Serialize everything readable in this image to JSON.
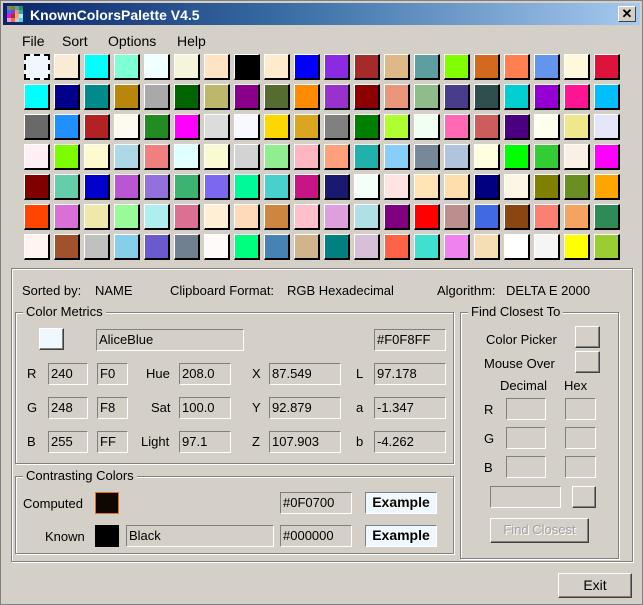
{
  "window": {
    "title": "KnownColorsPalette V4.5",
    "close_label": "✕"
  },
  "menu": [
    "File",
    "Sort",
    "Options",
    "Help"
  ],
  "palette": {
    "selected_index": 0,
    "colors": [
      {
        "name": "AliceBlue",
        "hex": "#F0F8FF"
      },
      {
        "name": "AntiqueWhite",
        "hex": "#FAEBD7"
      },
      {
        "name": "Aqua",
        "hex": "#00FFFF"
      },
      {
        "name": "Aquamarine",
        "hex": "#7FFFD4"
      },
      {
        "name": "Azure",
        "hex": "#F0FFFF"
      },
      {
        "name": "Beige",
        "hex": "#F5F5DC"
      },
      {
        "name": "Bisque",
        "hex": "#FFE4C4"
      },
      {
        "name": "Black",
        "hex": "#000000"
      },
      {
        "name": "BlanchedAlmond",
        "hex": "#FFEBCD"
      },
      {
        "name": "Blue",
        "hex": "#0000FF"
      },
      {
        "name": "BlueViolet",
        "hex": "#8A2BE2"
      },
      {
        "name": "Brown",
        "hex": "#A52A2A"
      },
      {
        "name": "BurlyWood",
        "hex": "#DEB887"
      },
      {
        "name": "CadetBlue",
        "hex": "#5F9EA0"
      },
      {
        "name": "Chartreuse",
        "hex": "#7FFF00"
      },
      {
        "name": "Chocolate",
        "hex": "#D2691E"
      },
      {
        "name": "Coral",
        "hex": "#FF7F50"
      },
      {
        "name": "CornflowerBlue",
        "hex": "#6495ED"
      },
      {
        "name": "Cornsilk",
        "hex": "#FFF8DC"
      },
      {
        "name": "Crimson",
        "hex": "#DC143C"
      },
      {
        "name": "Cyan",
        "hex": "#00FFFF"
      },
      {
        "name": "DarkBlue",
        "hex": "#00008B"
      },
      {
        "name": "DarkCyan",
        "hex": "#008B8B"
      },
      {
        "name": "DarkGoldenrod",
        "hex": "#B8860B"
      },
      {
        "name": "DarkGray",
        "hex": "#A9A9A9"
      },
      {
        "name": "DarkGreen",
        "hex": "#006400"
      },
      {
        "name": "DarkKhaki",
        "hex": "#BDB76B"
      },
      {
        "name": "DarkMagenta",
        "hex": "#8B008B"
      },
      {
        "name": "DarkOliveGreen",
        "hex": "#556B2F"
      },
      {
        "name": "DarkOrange",
        "hex": "#FF8C00"
      },
      {
        "name": "DarkOrchid",
        "hex": "#9932CC"
      },
      {
        "name": "DarkRed",
        "hex": "#8B0000"
      },
      {
        "name": "DarkSalmon",
        "hex": "#E9967A"
      },
      {
        "name": "DarkSeaGreen",
        "hex": "#8FBC8B"
      },
      {
        "name": "DarkSlateBlue",
        "hex": "#483D8B"
      },
      {
        "name": "DarkSlateGray",
        "hex": "#2F4F4F"
      },
      {
        "name": "DarkTurquoise",
        "hex": "#00CED1"
      },
      {
        "name": "DarkViolet",
        "hex": "#9400D3"
      },
      {
        "name": "DeepPink",
        "hex": "#FF1493"
      },
      {
        "name": "DeepSkyBlue",
        "hex": "#00BFFF"
      },
      {
        "name": "DimGray",
        "hex": "#696969"
      },
      {
        "name": "DodgerBlue",
        "hex": "#1E90FF"
      },
      {
        "name": "Firebrick",
        "hex": "#B22222"
      },
      {
        "name": "FloralWhite",
        "hex": "#FFFAF0"
      },
      {
        "name": "ForestGreen",
        "hex": "#228B22"
      },
      {
        "name": "Fuchsia",
        "hex": "#FF00FF"
      },
      {
        "name": "Gainsboro",
        "hex": "#DCDCDC"
      },
      {
        "name": "GhostWhite",
        "hex": "#F8F8FF"
      },
      {
        "name": "Gold",
        "hex": "#FFD700"
      },
      {
        "name": "Goldenrod",
        "hex": "#DAA520"
      },
      {
        "name": "Gray",
        "hex": "#808080"
      },
      {
        "name": "Green",
        "hex": "#008000"
      },
      {
        "name": "GreenYellow",
        "hex": "#ADFF2F"
      },
      {
        "name": "Honeydew",
        "hex": "#F0FFF0"
      },
      {
        "name": "HotPink",
        "hex": "#FF69B4"
      },
      {
        "name": "IndianRed",
        "hex": "#CD5C5C"
      },
      {
        "name": "Indigo",
        "hex": "#4B0082"
      },
      {
        "name": "Ivory",
        "hex": "#FFFFF0"
      },
      {
        "name": "Khaki",
        "hex": "#F0E68C"
      },
      {
        "name": "Lavender",
        "hex": "#E6E6FA"
      },
      {
        "name": "LavenderBlush",
        "hex": "#FFF0F5"
      },
      {
        "name": "LawnGreen",
        "hex": "#7CFC00"
      },
      {
        "name": "LemonChiffon",
        "hex": "#FFFACD"
      },
      {
        "name": "LightBlue",
        "hex": "#ADD8E6"
      },
      {
        "name": "LightCoral",
        "hex": "#F08080"
      },
      {
        "name": "LightCyan",
        "hex": "#E0FFFF"
      },
      {
        "name": "LightGoldenrodYellow",
        "hex": "#FAFAD2"
      },
      {
        "name": "LightGray",
        "hex": "#D3D3D3"
      },
      {
        "name": "LightGreen",
        "hex": "#90EE90"
      },
      {
        "name": "LightPink",
        "hex": "#FFB6C1"
      },
      {
        "name": "LightSalmon",
        "hex": "#FFA07A"
      },
      {
        "name": "LightSeaGreen",
        "hex": "#20B2AA"
      },
      {
        "name": "LightSkyBlue",
        "hex": "#87CEFA"
      },
      {
        "name": "LightSlateGray",
        "hex": "#778899"
      },
      {
        "name": "LightSteelBlue",
        "hex": "#B0C4DE"
      },
      {
        "name": "LightYellow",
        "hex": "#FFFFE0"
      },
      {
        "name": "Lime",
        "hex": "#00FF00"
      },
      {
        "name": "LimeGreen",
        "hex": "#32CD32"
      },
      {
        "name": "Linen",
        "hex": "#FAF0E6"
      },
      {
        "name": "Magenta",
        "hex": "#FF00FF"
      },
      {
        "name": "Maroon",
        "hex": "#800000"
      },
      {
        "name": "MediumAquamarine",
        "hex": "#66CDAA"
      },
      {
        "name": "MediumBlue",
        "hex": "#0000CD"
      },
      {
        "name": "MediumOrchid",
        "hex": "#BA55D3"
      },
      {
        "name": "MediumPurple",
        "hex": "#9370DB"
      },
      {
        "name": "MediumSeaGreen",
        "hex": "#3CB371"
      },
      {
        "name": "MediumSlateBlue",
        "hex": "#7B68EE"
      },
      {
        "name": "MediumSpringGreen",
        "hex": "#00FA9A"
      },
      {
        "name": "MediumTurquoise",
        "hex": "#48D1CC"
      },
      {
        "name": "MediumVioletRed",
        "hex": "#C71585"
      },
      {
        "name": "MidnightBlue",
        "hex": "#191970"
      },
      {
        "name": "MintCream",
        "hex": "#F5FFFA"
      },
      {
        "name": "MistyRose",
        "hex": "#FFE4E1"
      },
      {
        "name": "Moccasin",
        "hex": "#FFE4B5"
      },
      {
        "name": "NavajoWhite",
        "hex": "#FFDEAD"
      },
      {
        "name": "Navy",
        "hex": "#000080"
      },
      {
        "name": "OldLace",
        "hex": "#FDF5E6"
      },
      {
        "name": "Olive",
        "hex": "#808000"
      },
      {
        "name": "OliveDrab",
        "hex": "#6B8E23"
      },
      {
        "name": "Orange",
        "hex": "#FFA500"
      },
      {
        "name": "OrangeRed",
        "hex": "#FF4500"
      },
      {
        "name": "Orchid",
        "hex": "#DA70D6"
      },
      {
        "name": "PaleGoldenrod",
        "hex": "#EEE8AA"
      },
      {
        "name": "PaleGreen",
        "hex": "#98FB98"
      },
      {
        "name": "PaleTurquoise",
        "hex": "#AFEEEE"
      },
      {
        "name": "PaleVioletRed",
        "hex": "#DB7093"
      },
      {
        "name": "PapayaWhip",
        "hex": "#FFEFD5"
      },
      {
        "name": "PeachPuff",
        "hex": "#FFDAB9"
      },
      {
        "name": "Peru",
        "hex": "#CD853F"
      },
      {
        "name": "Pink",
        "hex": "#FFC0CB"
      },
      {
        "name": "Plum",
        "hex": "#DDA0DD"
      },
      {
        "name": "PowderBlue",
        "hex": "#B0E0E6"
      },
      {
        "name": "Purple",
        "hex": "#800080"
      },
      {
        "name": "Red",
        "hex": "#FF0000"
      },
      {
        "name": "RosyBrown",
        "hex": "#BC8F8F"
      },
      {
        "name": "RoyalBlue",
        "hex": "#4169E1"
      },
      {
        "name": "SaddleBrown",
        "hex": "#8B4513"
      },
      {
        "name": "Salmon",
        "hex": "#FA8072"
      },
      {
        "name": "SandyBrown",
        "hex": "#F4A460"
      },
      {
        "name": "SeaGreen",
        "hex": "#2E8B57"
      },
      {
        "name": "SeaShell",
        "hex": "#FFF5EE"
      },
      {
        "name": "Sienna",
        "hex": "#A0522D"
      },
      {
        "name": "Silver",
        "hex": "#C0C0C0"
      },
      {
        "name": "SkyBlue",
        "hex": "#87CEEB"
      },
      {
        "name": "SlateBlue",
        "hex": "#6A5ACD"
      },
      {
        "name": "SlateGray",
        "hex": "#708090"
      },
      {
        "name": "Snow",
        "hex": "#FFFAFA"
      },
      {
        "name": "SpringGreen",
        "hex": "#00FF7F"
      },
      {
        "name": "SteelBlue",
        "hex": "#4682B4"
      },
      {
        "name": "Tan",
        "hex": "#D2B48C"
      },
      {
        "name": "Teal",
        "hex": "#008080"
      },
      {
        "name": "Thistle",
        "hex": "#D8BFD8"
      },
      {
        "name": "Tomato",
        "hex": "#FF6347"
      },
      {
        "name": "Turquoise",
        "hex": "#40E0D0"
      },
      {
        "name": "Violet",
        "hex": "#EE82EE"
      },
      {
        "name": "Wheat",
        "hex": "#F5DEB3"
      },
      {
        "name": "White",
        "hex": "#FFFFFF"
      },
      {
        "name": "WhiteSmoke",
        "hex": "#F5F5F5"
      },
      {
        "name": "Yellow",
        "hex": "#FFFF00"
      },
      {
        "name": "YellowGreen",
        "hex": "#9ACD32"
      }
    ]
  },
  "status": {
    "sorted_by_label": "Sorted by:",
    "sorted_by_value": "NAME",
    "clipboard_label": "Clipboard Format:",
    "clipboard_value": "RGB Hexadecimal",
    "algorithm_label": "Algorithm:",
    "algorithm_value": "DELTA E 2000"
  },
  "metrics": {
    "group_label": "Color Metrics",
    "swatch_color": "#F0F8FF",
    "name": "AliceBlue",
    "hex": "#F0F8FF",
    "rgb": [
      {
        "label": "R",
        "dec": "240",
        "hex": "F0"
      },
      {
        "label": "G",
        "dec": "248",
        "hex": "F8"
      },
      {
        "label": "B",
        "dec": "255",
        "hex": "FF"
      }
    ],
    "hsl": [
      {
        "label": "Hue",
        "value": "208.0"
      },
      {
        "label": "Sat",
        "value": "100.0"
      },
      {
        "label": "Light",
        "value": "97.1"
      }
    ],
    "xyz": [
      {
        "label": "X",
        "value": "87.549"
      },
      {
        "label": "Y",
        "value": "92.879"
      },
      {
        "label": "Z",
        "value": "107.903"
      }
    ],
    "lab": [
      {
        "label": "L",
        "value": "97.178"
      },
      {
        "label": "a",
        "value": "-1.347"
      },
      {
        "label": "b",
        "value": "-4.262"
      }
    ]
  },
  "contrast": {
    "group_label": "Contrasting Colors",
    "computed": {
      "label": "Computed",
      "color": "#0F0700",
      "hex": "#0F0700",
      "example": "Example"
    },
    "known": {
      "label": "Known",
      "color": "#000000",
      "name": "Black",
      "hex": "#000000",
      "example": "Example"
    }
  },
  "find": {
    "group_label": "Find Closest To",
    "color_picker_label": "Color Picker",
    "mouse_over_label": "Mouse Over",
    "decimal_header": "Decimal",
    "hex_header": "Hex",
    "rows": [
      {
        "label": "R",
        "dec": "",
        "hex": ""
      },
      {
        "label": "G",
        "dec": "",
        "hex": ""
      },
      {
        "label": "B",
        "dec": "",
        "hex": ""
      }
    ],
    "result_value": "",
    "find_button": "Find Closest"
  },
  "exit_button": "Exit",
  "app_icon_colors": [
    "#808080",
    "#6b8e23",
    "#5f9ea0",
    "#2e8b57",
    "#4169e1",
    "#9932cc",
    "#e9967a",
    "#20b2aa",
    "#ff00ff",
    "#8b4513",
    "#ffa07a",
    "#afeeee",
    "#dda0dd",
    "#ff6347",
    "#d8bfd8",
    "#40e0d0"
  ]
}
